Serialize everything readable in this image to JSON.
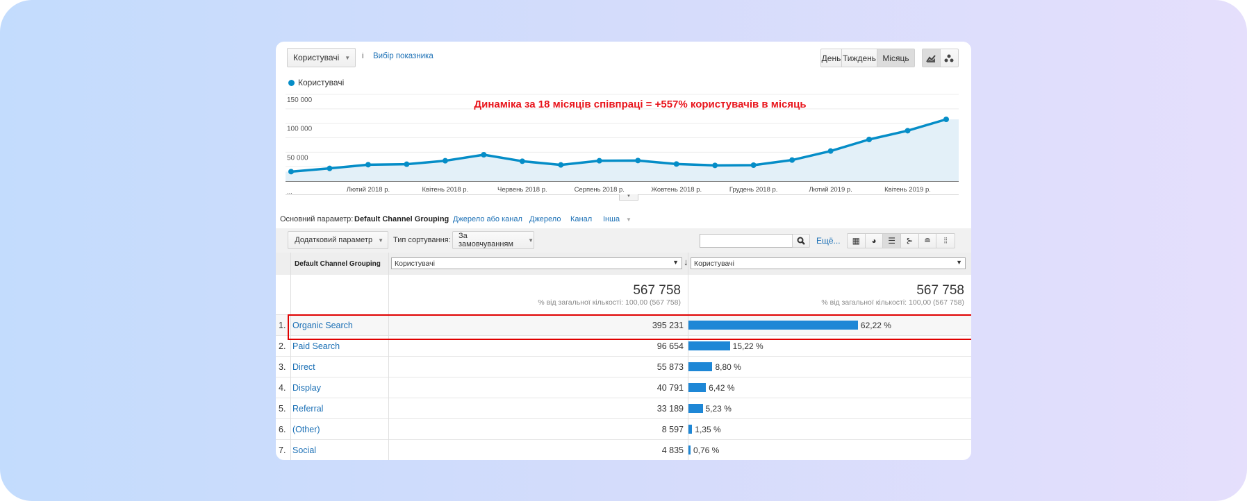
{
  "colors": {
    "accent": "#058dc7",
    "bar": "#1e87d6",
    "link": "#1a6fb5",
    "annotation": "#e8141b",
    "highlight": "#e00000"
  },
  "header": {
    "metric_dropdown": "Користувачі",
    "info": "i",
    "choose_metric": "Вибір показника",
    "granularity": [
      {
        "label": "День",
        "active": false
      },
      {
        "label": "Тиждень",
        "active": false
      },
      {
        "label": "Місяць",
        "active": true
      }
    ],
    "chart_type_icons": [
      "line-chart-icon",
      "motion-chart-icon"
    ]
  },
  "chart_data": {
    "type": "area",
    "legend": "Користувачі",
    "legend_placement": "top-left",
    "annotation": "Динаміка за 18 місяців співпраці = +557% користувачів в місяць",
    "y_ticks": [
      "150 000",
      "100 000",
      "50 000"
    ],
    "ylim": [
      0,
      150000
    ],
    "grid": true,
    "x_first_label": "...",
    "x_tick_labels": [
      {
        "index": 2,
        "label": "Лютий 2018 р."
      },
      {
        "index": 4,
        "label": "Квітень 2018 р."
      },
      {
        "index": 6,
        "label": "Червень 2018 р."
      },
      {
        "index": 8,
        "label": "Серпень 2018 р."
      },
      {
        "index": 10,
        "label": "Жовтень 2018 р."
      },
      {
        "index": 12,
        "label": "Грудень 2018 р."
      },
      {
        "index": 14,
        "label": "Лютий 2019 р."
      },
      {
        "index": 16,
        "label": "Квітень 2019 р."
      }
    ],
    "series": [
      {
        "name": "Користувачі",
        "values": [
          16400,
          22000,
          28400,
          29200,
          35200,
          45600,
          34400,
          28000,
          35200,
          35600,
          29600,
          27200,
          27600,
          36400,
          52000,
          72000,
          87200,
          106800
        ]
      }
    ]
  },
  "dimension_bar": {
    "label": "Основний параметр:",
    "active": "Default Channel Grouping",
    "options": [
      "Джерело або канал",
      "Джерело",
      "Канал",
      "Інша"
    ]
  },
  "toolbar": {
    "secondary": "Додатковий параметр",
    "sort_label": "Тип сортування:",
    "sort_value": "За замовчуванням",
    "search_placeholder": "",
    "more": "Ещё..."
  },
  "table": {
    "dim_header": "Default Channel Grouping",
    "metric1": "Користувачі",
    "metric2": "Користувачі",
    "total": "567 758",
    "total_sub": "% від загальної кількості: 100,00 (567 758)",
    "rows": [
      {
        "n": "1.",
        "name": "Organic Search",
        "value": "395 231",
        "pct": "62,22 %",
        "share": 62.22
      },
      {
        "n": "2.",
        "name": "Paid Search",
        "value": "96 654",
        "pct": "15,22 %",
        "share": 15.22
      },
      {
        "n": "3.",
        "name": "Direct",
        "value": "55 873",
        "pct": "8,80 %",
        "share": 8.8
      },
      {
        "n": "4.",
        "name": "Display",
        "value": "40 791",
        "pct": "6,42 %",
        "share": 6.42
      },
      {
        "n": "5.",
        "name": "Referral",
        "value": "33 189",
        "pct": "5,23 %",
        "share": 5.23
      },
      {
        "n": "6.",
        "name": "(Other)",
        "value": "8 597",
        "pct": "1,35 %",
        "share": 1.35
      },
      {
        "n": "7.",
        "name": "Social",
        "value": "4 835",
        "pct": "0,76 %",
        "share": 0.76
      }
    ]
  }
}
